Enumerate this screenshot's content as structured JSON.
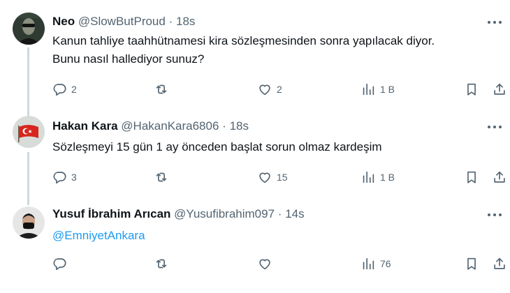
{
  "tweets": [
    {
      "name": "Neo",
      "handle": "@SlowButProud",
      "separator": "·",
      "time": "18s",
      "lines": [
        "Kanun tahliye taahhütnamesi kira sözleşmesinden sonra yapılacak diyor.",
        "Bunu nasıl hallediyor sunuz?"
      ],
      "replies": "2",
      "retweets": "",
      "likes": "2",
      "views": "1 B"
    },
    {
      "name": "Hakan Kara",
      "handle": "@HakanKara6806",
      "separator": "·",
      "time": "18s",
      "lines": [
        "Sözleşmeyi 15 gün 1 ay önceden başlat sorun olmaz kardeşim"
      ],
      "replies": "3",
      "retweets": "",
      "likes": "15",
      "views": "1 B"
    },
    {
      "name": "Yusuf İbrahim Arıcan",
      "handle": "@Yusufibrahim097",
      "separator": "·",
      "time": "14s",
      "mention": "@EmniyetAnkara",
      "replies": "",
      "retweets": "",
      "likes": "",
      "views": "76"
    }
  ],
  "colors": {
    "text": "#0f1419",
    "secondary": "#536471",
    "link": "#1d9bf0",
    "thread_line": "#cfd9de"
  },
  "icons": [
    "reply-icon",
    "retweet-icon",
    "like-icon",
    "views-icon",
    "bookmark-icon",
    "share-icon",
    "more-icon"
  ]
}
